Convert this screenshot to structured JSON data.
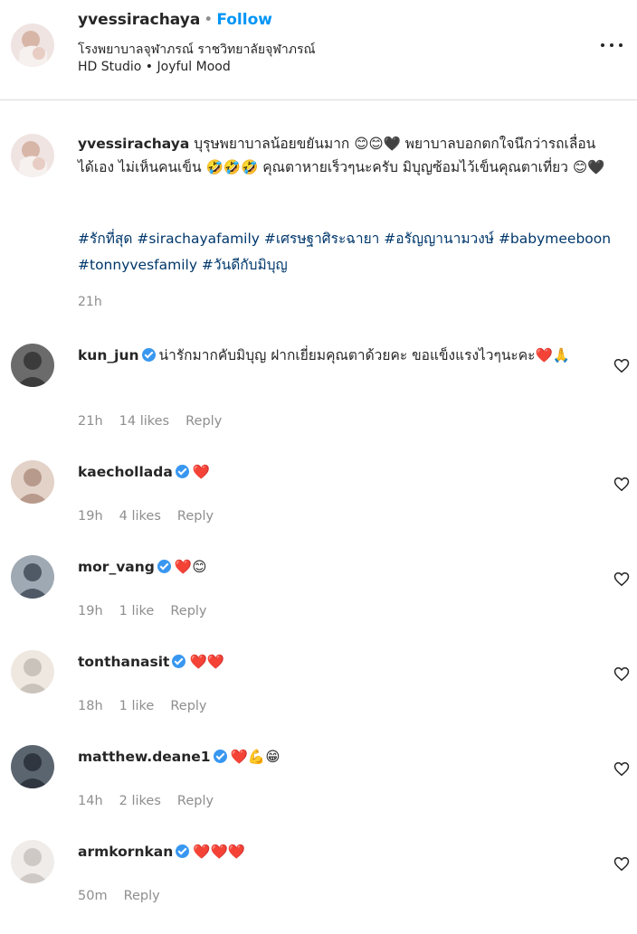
{
  "header": {
    "username": "yvessirachaya",
    "separator": "•",
    "follow_label": "Follow",
    "location": "โรงพยาบาลจุฬาภรณ์ ราชวิทยาลัยจุฬาภรณ์",
    "audio": "HD Studio • Joyful Mood"
  },
  "caption": {
    "username": "yvessirachaya",
    "text": "บุรุษพยาบาลน้อยขยันมาก 😊😊🖤 พยาบาลบอกตกใจนึกว่ารถเลื่อนได้เอง ไม่เห็นคนเข็น 🤣🤣🤣 คุณตาหายเร็วๆนะครับ มิบุญซ้อมไว้เข็นคุณตาเที่ยว 😊🖤",
    "hashtags": "#รักที่สุด #sirachayafamily #เศรษฐาศิระฉายา #อรัญญานามวงษ์ #babymeeboon #tonnyvesfamily #วันดีกับมิบุญ",
    "time": "21h"
  },
  "comments": [
    {
      "username": "kun_jun",
      "verified": true,
      "text": "น่ารักมากคับมิบุญ ฝากเยี่ยมคุณตาด้วยคะ ขอแข็งแรงไวๆนะคะ❤️🙏",
      "time": "21h",
      "likes": "14 likes",
      "reply": "Reply"
    },
    {
      "username": "kaechollada",
      "verified": true,
      "text": "❤️",
      "time": "19h",
      "likes": "4 likes",
      "reply": "Reply"
    },
    {
      "username": "mor_vang",
      "verified": true,
      "text": "❤️😊",
      "time": "19h",
      "likes": "1 like",
      "reply": "Reply"
    },
    {
      "username": "tonthanasit",
      "verified": true,
      "text": "❤️❤️",
      "time": "18h",
      "likes": "1 like",
      "reply": "Reply"
    },
    {
      "username": "matthew.deane1",
      "verified": true,
      "text": "❤️💪😁",
      "time": "14h",
      "likes": "2 likes",
      "reply": "Reply"
    },
    {
      "username": "armkornkan",
      "verified": true,
      "text": "❤️❤️❤️",
      "time": "50m",
      "likes": "",
      "reply": "Reply"
    }
  ],
  "icons": {
    "more": "more-options-icon",
    "like": "heart-outline-icon",
    "verified": "verified-badge-icon"
  },
  "colors": {
    "link_blue": "#0095f6",
    "hashtag": "#00376b",
    "secondary_text": "#8e8e8e",
    "verified": "#3897f0"
  }
}
